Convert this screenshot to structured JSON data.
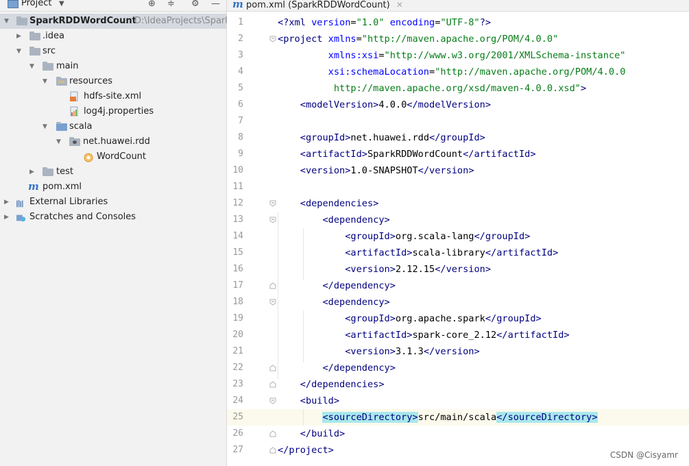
{
  "project_panel": {
    "title": "Project",
    "tree": [
      {
        "label": "SparkRDDWordCount",
        "path": "D:\\IdeaProjects\\Spark"
      },
      {
        "label": ".idea"
      },
      {
        "label": "src"
      },
      {
        "label": "main"
      },
      {
        "label": "resources"
      },
      {
        "label": "hdfs-site.xml"
      },
      {
        "label": "log4j.properties"
      },
      {
        "label": "scala"
      },
      {
        "label": "net.huawei.rdd"
      },
      {
        "label": "WordCount"
      },
      {
        "label": "test"
      },
      {
        "label": "pom.xml"
      },
      {
        "label": "External Libraries"
      },
      {
        "label": "Scratches and Consoles"
      }
    ]
  },
  "editor": {
    "tab_label": "pom.xml (SparkRDDWordCount)",
    "line_numbers": [
      "1",
      "2",
      "3",
      "4",
      "5",
      "6",
      "7",
      "8",
      "9",
      "10",
      "11",
      "12",
      "13",
      "14",
      "15",
      "16",
      "17",
      "18",
      "19",
      "20",
      "21",
      "22",
      "23",
      "24",
      "25",
      "26",
      "27"
    ],
    "lines": [
      "<?xml version=\"1.0\" encoding=\"UTF-8\"?>",
      "<project xmlns=\"http://maven.apache.org/POM/4.0.0\"",
      "         xmlns:xsi=\"http://www.w3.org/2001/XMLSchema-instance\"",
      "         xsi:schemaLocation=\"http://maven.apache.org/POM/4.0.0",
      "          http://maven.apache.org/xsd/maven-4.0.0.xsd\">",
      "    <modelVersion>4.0.0</modelVersion>",
      "",
      "    <groupId>net.huawei.rdd</groupId>",
      "    <artifactId>SparkRDDWordCount</artifactId>",
      "    <version>1.0-SNAPSHOT</version>",
      "",
      "    <dependencies>",
      "        <dependency>",
      "            <groupId>org.scala-lang</groupId>",
      "            <artifactId>scala-library</artifactId>",
      "            <version>2.12.15</version>",
      "        </dependency>",
      "        <dependency>",
      "            <groupId>org.apache.spark</groupId>",
      "            <artifactId>spark-core_2.12</artifactId>",
      "            <version>3.1.3</version>",
      "        </dependency>",
      "    </dependencies>",
      "    <build>",
      "        <sourceDirectory>src/main/scala</sourceDirectory>",
      "    </build>",
      "</project>"
    ]
  },
  "watermark": "CSDN @Cisyamr",
  "colors": {
    "tag": "#000080",
    "attr_name": "#0000ff",
    "attr_value": "#067d17",
    "highlight": "#a9e8ed",
    "current_line": "#fcfaed"
  }
}
